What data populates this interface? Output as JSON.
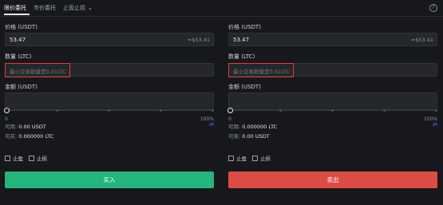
{
  "tabs": [
    {
      "label": "限价委托"
    },
    {
      "label": "市价委托"
    },
    {
      "label": "止盈止损"
    }
  ],
  "left": {
    "price_label": "价格 (USDT)",
    "price_value": "53.47",
    "price_suffix": "≈$53.41",
    "qty_label": "数量 (LTC)",
    "qty_placeholder": "最小交易数量是0.01LTC",
    "amount_label": "金额 (USDT)",
    "slider_min": "0",
    "slider_max": "100%",
    "slider_value_percent": 0,
    "available_label": "可用:",
    "available_value": "0.00 USDT",
    "can_label": "可买:",
    "can_value": "0.000000 LTC",
    "take_profit": "止盈",
    "stop_loss": "止损",
    "action": "买入",
    "action_color": "#23b57c"
  },
  "right": {
    "price_label": "价格 (USDT)",
    "price_value": "53.47",
    "price_suffix": "≈$53.41",
    "qty_label": "数量 (LTC)",
    "qty_placeholder": "最小交易数量是0.01LTC",
    "amount_label": "金额 (USDT)",
    "slider_min": "0",
    "slider_max": "100%",
    "slider_value_percent": 0,
    "available_label": "可用:",
    "available_value": "0.000000 LTC",
    "can_label": "可卖:",
    "can_value": "0.00 USDT",
    "take_profit": "止盈",
    "stop_loss": "止损",
    "action": "卖出",
    "action_color": "#dc4c45"
  }
}
